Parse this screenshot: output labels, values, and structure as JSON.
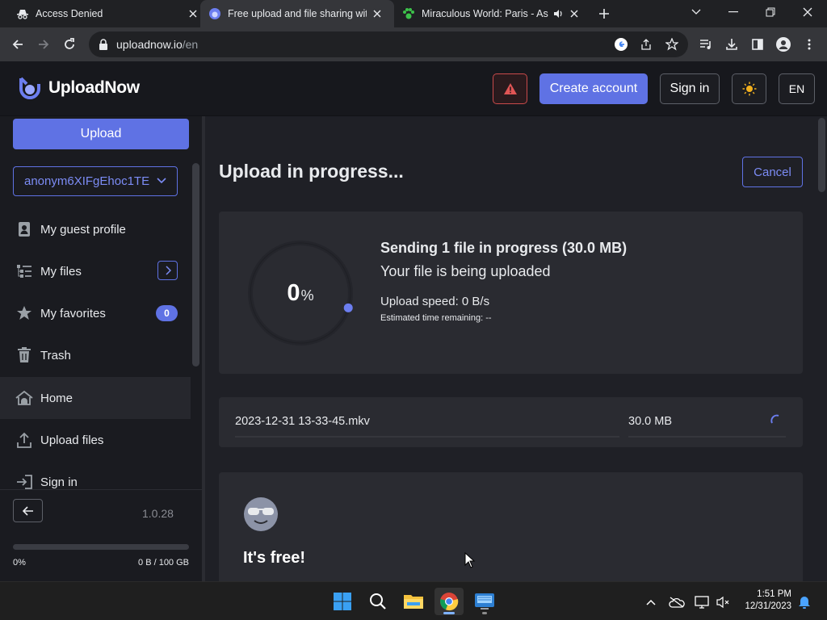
{
  "browser": {
    "tabs": [
      {
        "title": "Access Denied",
        "active": false
      },
      {
        "title": "Free upload and file sharing with",
        "active": true
      },
      {
        "title": "Miraculous World: Paris - As",
        "active": false,
        "audio": true
      }
    ],
    "url_host": "uploadnow.io",
    "url_path": "/en"
  },
  "header": {
    "brand": "UploadNow",
    "create_account": "Create account",
    "sign_in": "Sign in",
    "language": "EN"
  },
  "sidebar": {
    "upload_label": "Upload",
    "user_name": "anonym6XIFgEhoc1TE",
    "items": [
      {
        "label": "My guest profile",
        "icon": "user-card-icon"
      },
      {
        "label": "My files",
        "icon": "files-tree-icon"
      },
      {
        "label": "My favorites",
        "icon": "star-icon",
        "badge": "0"
      },
      {
        "label": "Trash",
        "icon": "trash-icon"
      },
      {
        "label": "Home",
        "icon": "home-icon",
        "active": true
      },
      {
        "label": "Upload files",
        "icon": "upload-icon"
      },
      {
        "label": "Sign in",
        "icon": "sign-in-icon"
      }
    ],
    "version": "1.0.28",
    "storage_percent_label": "0%",
    "storage_used_label": "0 B / 100 GB",
    "storage_fraction": 0
  },
  "main": {
    "title": "Upload in progress...",
    "cancel_label": "Cancel",
    "progress": {
      "percent_value": "0",
      "percent_sign": "%",
      "fraction": 0,
      "sending": "Sending 1 file in progress (30.0 MB)",
      "status": "Your file is being uploaded",
      "speed": "Upload speed: 0 B/s",
      "eta": "Estimated time remaining: --"
    },
    "file": {
      "name": "2023-12-31 13-33-45.mkv",
      "size": "30.0 MB"
    },
    "free_title": "It's free!"
  },
  "taskbar": {
    "time": "1:51 PM",
    "date": "12/31/2023"
  },
  "colors": {
    "accent": "#5f72e4",
    "alert": "#e05555"
  }
}
